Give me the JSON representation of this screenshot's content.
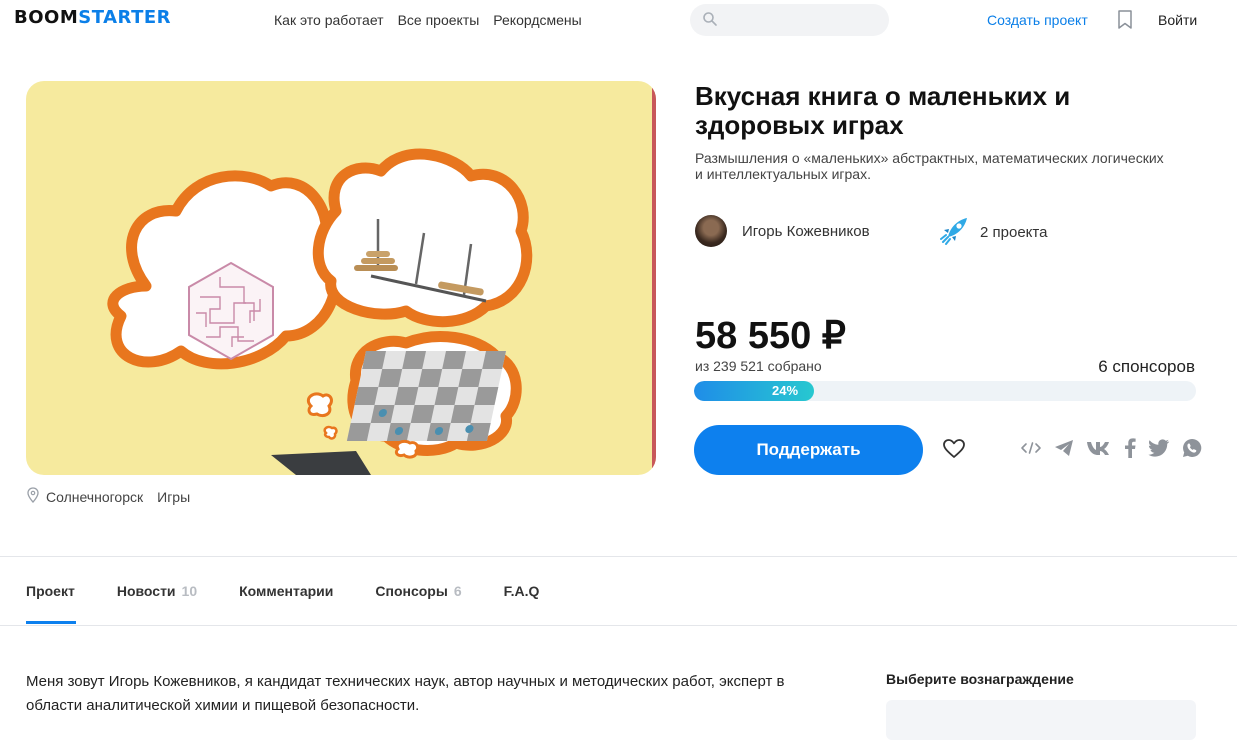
{
  "header": {
    "logo_part1": "BOOM",
    "logo_part2": "STARTER",
    "nav": [
      "Как это работает",
      "Все проекты",
      "Рекордсмены"
    ],
    "search_placeholder": "",
    "create_project": "Создать проект",
    "login": "Войти"
  },
  "project": {
    "title": "Вкусная книга о маленьких и здоровых играх",
    "subtitle": "Размышления о «маленьких» абстрактных, математических логических и интеллектуальных играх.",
    "author": "Игорь Кожевников",
    "projects_count": "2 проекта",
    "location": "Солнечногорск",
    "category": "Игры"
  },
  "funding": {
    "amount": "58 550 ₽",
    "collected_text": "из 239 521 собрано",
    "sponsors": "6 спонсоров",
    "progress_percent": 24,
    "progress_label": "24%",
    "support_button": "Поддержать"
  },
  "share_icons": [
    "embed-icon",
    "telegram-icon",
    "vk-icon",
    "facebook-icon",
    "twitter-icon",
    "whatsapp-icon"
  ],
  "tabs": [
    {
      "label": "Проект",
      "count": ""
    },
    {
      "label": "Новости",
      "count": "10"
    },
    {
      "label": "Комментарии",
      "count": ""
    },
    {
      "label": "Спонсоры",
      "count": "6"
    },
    {
      "label": "F.A.Q",
      "count": ""
    }
  ],
  "content": {
    "intro": "Меня зовут Игорь Кожевников, я кандидат технических наук, автор научных и методических работ, эксперт в области аналитической химии и пищевой безопасности."
  },
  "sidebar": {
    "reward_title": "Выберите вознаграждение"
  },
  "colors": {
    "accent": "#0d80ee",
    "hero_background": "#f6ea9e",
    "bubble_outline": "#e8761e"
  }
}
